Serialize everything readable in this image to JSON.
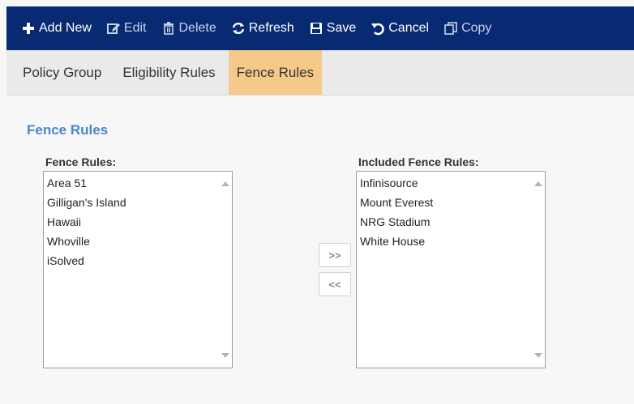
{
  "toolbar": {
    "add_new": "Add New",
    "edit": "Edit",
    "delete": "Delete",
    "refresh": "Refresh",
    "save": "Save",
    "cancel": "Cancel",
    "copy": "Copy"
  },
  "tabs": [
    {
      "label": "Policy Group"
    },
    {
      "label": "Eligibility Rules"
    },
    {
      "label": "Fence Rules"
    }
  ],
  "section_title": "Fence Rules",
  "available": {
    "label": "Fence Rules:",
    "items": [
      "Area 51",
      "Gilligan's Island",
      "Hawaii",
      "Whoville",
      "iSolved"
    ]
  },
  "included": {
    "label": "Included Fence Rules:",
    "items": [
      "Infinisource",
      "Mount Everest",
      "NRG Stadium",
      "White House"
    ]
  },
  "move_right_label": ">>",
  "move_left_label": "<<",
  "colors": {
    "toolbar_bg": "#082a73",
    "active_tab": "#f6c98a",
    "section_title": "#4a86c8"
  }
}
